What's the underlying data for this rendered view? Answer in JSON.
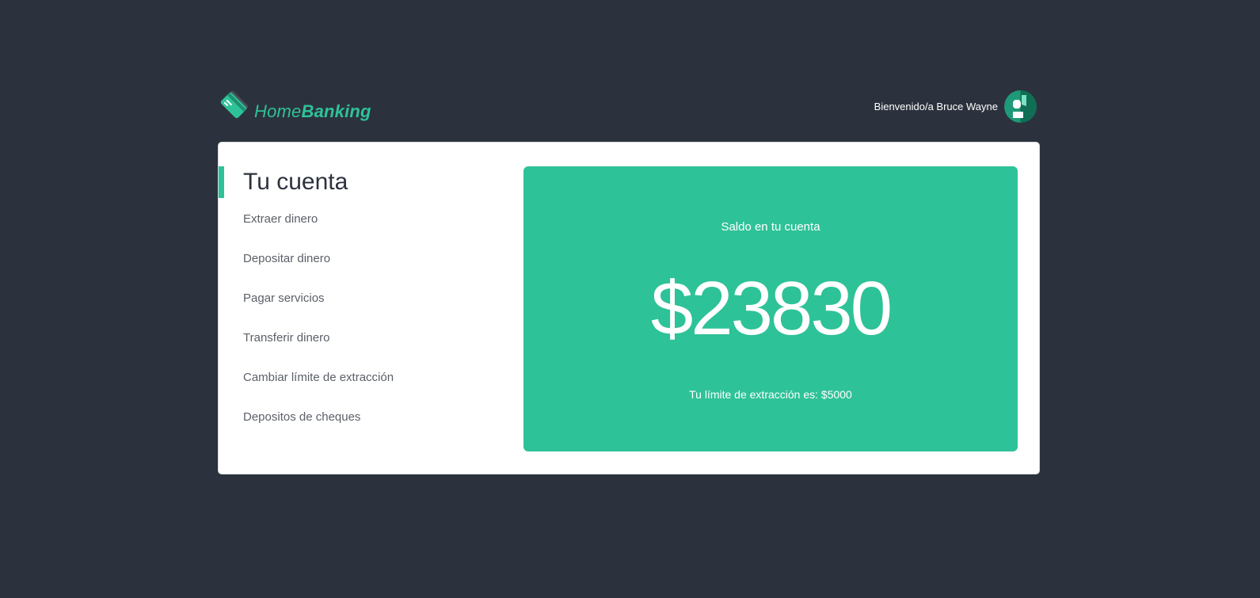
{
  "brand": {
    "name_light": "Home",
    "name_bold": "Banking",
    "logo_icon": "credit-card-icon",
    "accent_color": "#2ec298",
    "background_color": "#2c323d"
  },
  "user": {
    "welcome": "Bienvenido/a Bruce Wayne",
    "avatar_icon": "user-avatar-icon"
  },
  "account": {
    "title": "Tu cuenta",
    "menu": [
      "Extraer dinero",
      "Depositar dinero",
      "Pagar servicios",
      "Transferir dinero",
      "Cambiar límite de extracción",
      "Depositos de cheques"
    ]
  },
  "balance": {
    "label": "Saldo en tu cuenta",
    "amount": "$23830",
    "limit": "Tu límite de extracción es: $5000"
  }
}
